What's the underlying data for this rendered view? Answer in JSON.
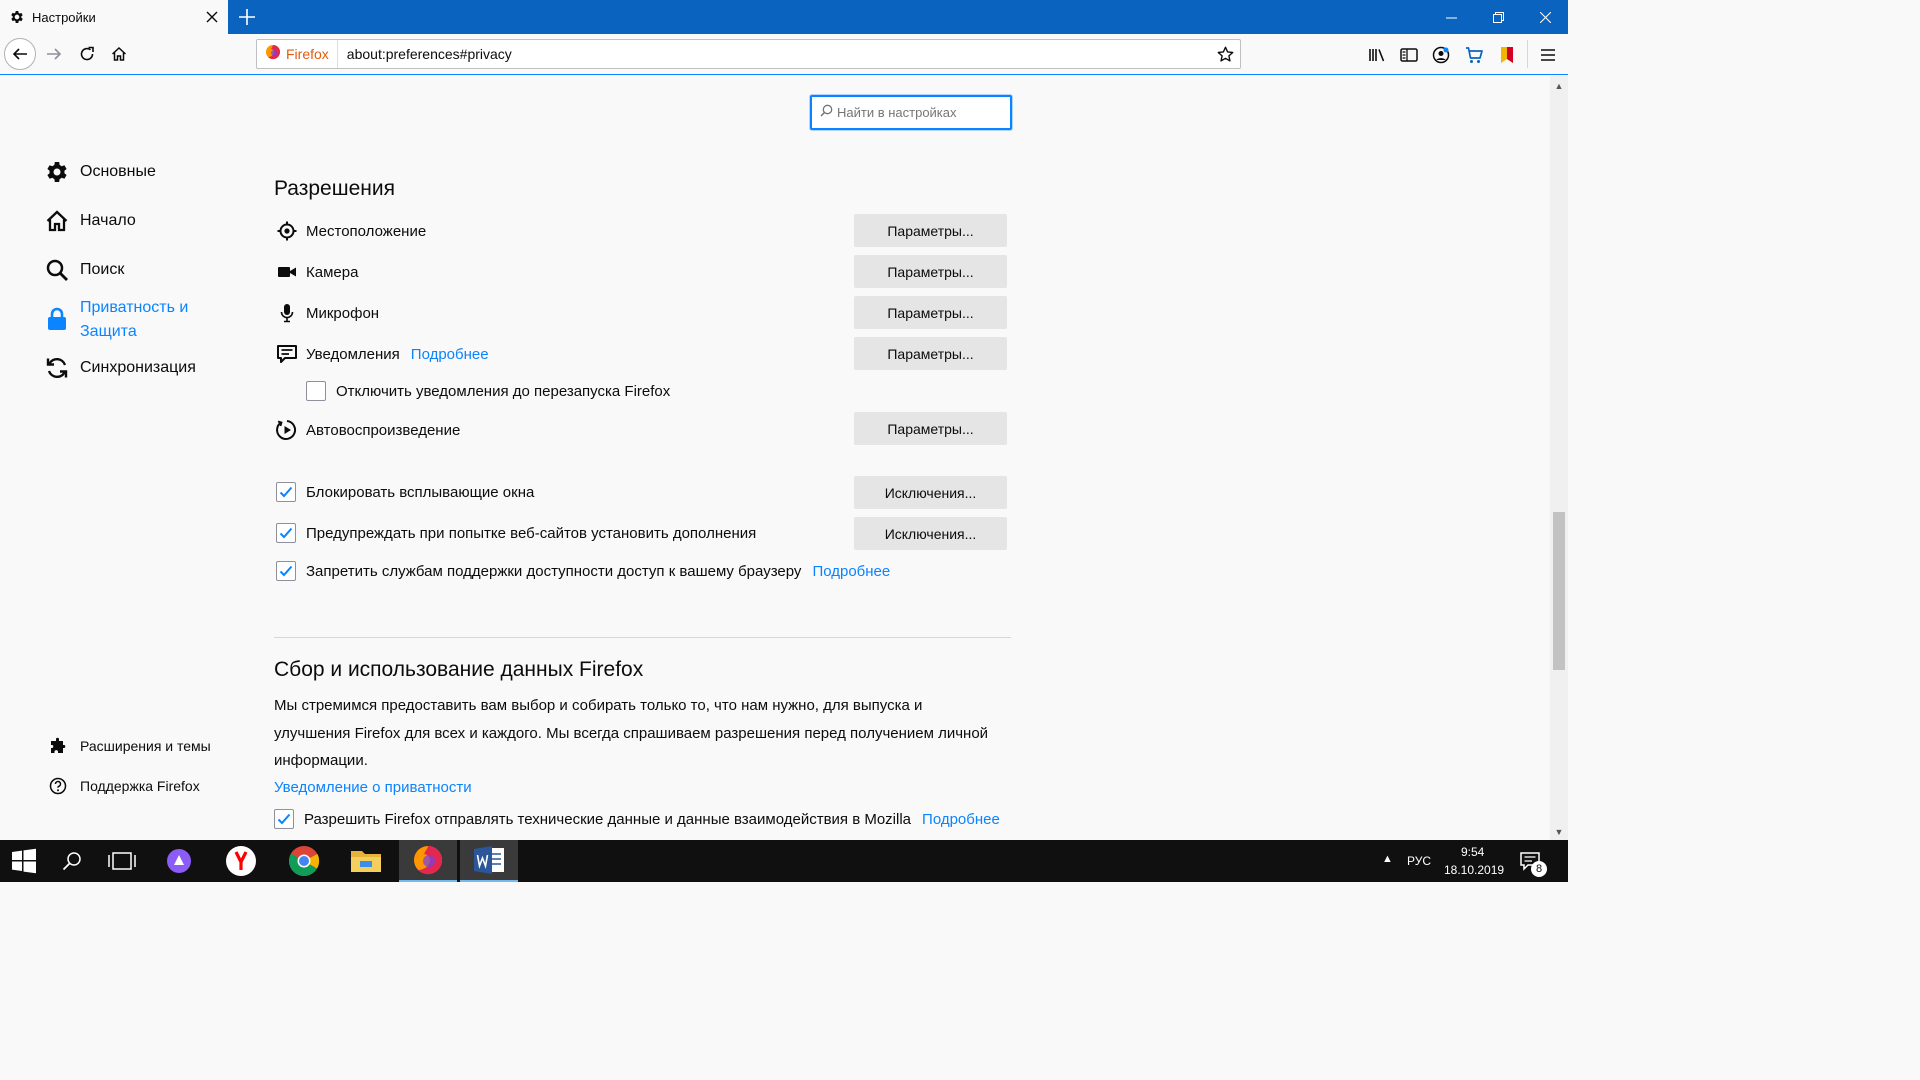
{
  "window": {
    "tab_title": "Настройки",
    "colors": {
      "titlebar": "#0a64bf",
      "accent": "#0a84ff",
      "firefox_label": "#e35b0b"
    }
  },
  "urlbar": {
    "identity_label": "Firefox",
    "url": "about:preferences#privacy"
  },
  "search": {
    "placeholder": "Найти в настройках"
  },
  "sidebar": {
    "items": [
      {
        "label": "Основные",
        "icon": "gear-icon"
      },
      {
        "label": "Начало",
        "icon": "home-icon"
      },
      {
        "label": "Поиск",
        "icon": "search-icon"
      },
      {
        "label_line1": "Приватность и",
        "label_line2": "Защита",
        "icon": "lock-icon",
        "selected": true
      },
      {
        "label": "Синхронизация",
        "icon": "sync-icon"
      }
    ],
    "footer": [
      {
        "label": "Расширения и темы",
        "icon": "puzzle-icon"
      },
      {
        "label": "Поддержка Firefox",
        "icon": "help-icon"
      }
    ]
  },
  "permissions": {
    "heading": "Разрешения",
    "location": {
      "label": "Местоположение",
      "button": "Параметры..."
    },
    "camera": {
      "label": "Камера",
      "button": "Параметры..."
    },
    "microphone": {
      "label": "Микрофон",
      "button": "Параметры..."
    },
    "notifications": {
      "label": "Уведомления",
      "link": "Подробнее",
      "button": "Параметры..."
    },
    "pause_notifications": {
      "label": "Отключить уведомления до перезапуска Firefox",
      "checked": false
    },
    "autoplay": {
      "label": "Автовоспроизведение",
      "button": "Параметры..."
    },
    "block_popups": {
      "label": "Блокировать всплывающие окна",
      "button": "Исключения...",
      "checked": true
    },
    "warn_addons": {
      "label": "Предупреждать при попытке веб-сайтов установить дополнения",
      "button": "Исключения...",
      "checked": true
    },
    "a11y_block": {
      "label": "Запретить службам поддержки доступности доступ к вашему браузеру",
      "link": "Подробнее",
      "checked": true
    }
  },
  "data_collection": {
    "heading": "Сбор и использование данных Firefox",
    "description_line1": "Мы стремимся предоставить вам выбор и собирать только то, что нам нужно, для выпуска и",
    "description_line2": "улучшения Firefox для всех и каждого. Мы всегда спрашиваем разрешения перед получением личной",
    "description_line3": "информации.",
    "privacy_notice_link": "Уведомление о приватности",
    "telemetry": {
      "label": "Разрешить Firefox отправлять технические данные и данные взаимодействия в Mozilla",
      "link": "Подробнее",
      "checked": true
    }
  },
  "taskbar": {
    "language": "РУС",
    "time": "9:54",
    "date": "18.10.2019",
    "notification_count": "8"
  }
}
